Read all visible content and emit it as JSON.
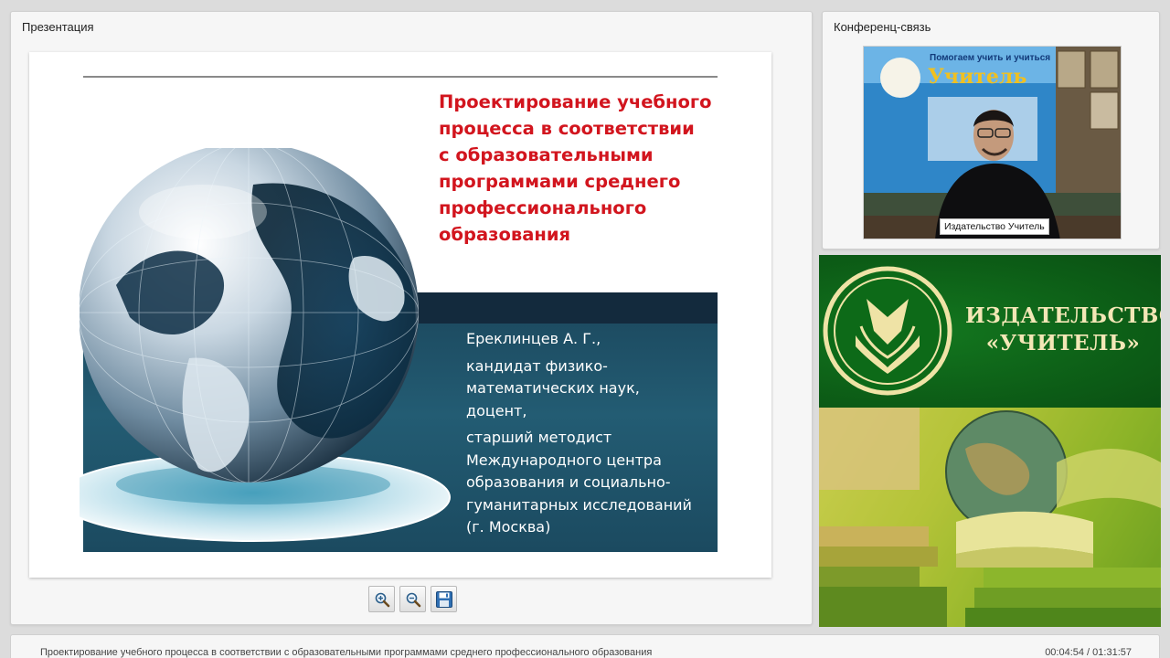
{
  "presentation": {
    "panel_title": "Презентация",
    "slide": {
      "title": "Проектирование учебного\nпроцесса в соответствии\nс образовательными\nпрограммами среднего\nпрофессионального\nобразования",
      "author_lines": [
        "Ереклинцев А. Г.,",
        "кандидат физико-",
        "математических наук,",
        "доцент,",
        "старший методист",
        "Международного центра",
        "образования и социально-",
        "гуманитарных исследований",
        "(г. Москва)"
      ]
    },
    "toolbar": {
      "zoom_in_icon": "zoom-in-icon",
      "zoom_out_icon": "zoom-out-icon",
      "save_icon": "floppy-disk-icon"
    }
  },
  "conference": {
    "panel_title": "Конференц-связь",
    "video_caption": "Издательство Учитель",
    "backdrop_text": [
      "Помогаем учить и учиться",
      "Учитель"
    ]
  },
  "banner": {
    "name": "ИЗДАТЕЛЬСТВО\n«УЧИТЕЛЬ»"
  },
  "footer": {
    "title": "Проектирование учебного процесса в соответствии с образовательными программами среднего профессионального образования",
    "time": "00:04:54 / 01:31:57"
  },
  "colors": {
    "slide_title": "#d2151e",
    "slide_band": "#1d4c62",
    "banner_green": "#0d5f17",
    "banner_text": "#f3e7b6"
  }
}
